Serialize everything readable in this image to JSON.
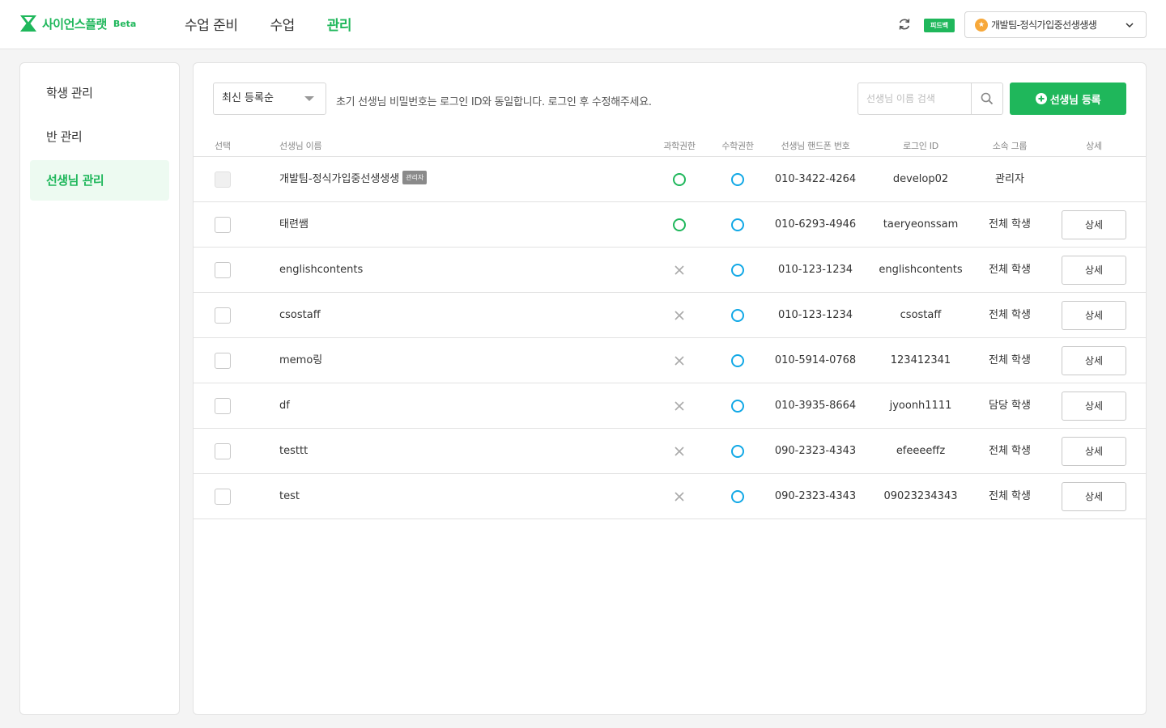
{
  "app": {
    "logo_text": "사이언스플랫",
    "beta": "Beta",
    "brand_color": "#1fb75b"
  },
  "nav": {
    "items": [
      {
        "label": "수업 준비",
        "active": false
      },
      {
        "label": "수업",
        "active": false
      },
      {
        "label": "관리",
        "active": true
      }
    ]
  },
  "header": {
    "feedback_label": "피드백",
    "user_badge": "★",
    "user_name": "개발팀-정식가입중선생생생"
  },
  "sidebar": {
    "items": [
      {
        "label": "학생 관리",
        "active": false
      },
      {
        "label": "반 관리",
        "active": false
      },
      {
        "label": "선생님 관리",
        "active": true
      }
    ]
  },
  "toolbar": {
    "sort_value": "최신 등록순",
    "notice": "초기 선생님 비밀번호는 로그인 ID와 동일합니다. 로그인 후 수정해주세요.",
    "search_placeholder": "선생님 이름 검색",
    "add_label": "선생님 등록"
  },
  "table": {
    "headers": {
      "select": "선택",
      "name": "선생님 이름",
      "science": "과학권한",
      "math": "수학권한",
      "phone": "선생님 핸드폰 번호",
      "login": "로그인 ID",
      "group": "소속 그룹",
      "detail": "상세"
    },
    "admin_tag": "관리자",
    "detail_label": "상세",
    "rows": [
      {
        "name": "개발팀-정식가입중선생생생",
        "admin": true,
        "science": true,
        "math": true,
        "phone": "010-3422-4264",
        "login": "develop02",
        "group": "관리자"
      },
      {
        "name": "태련쌤",
        "admin": false,
        "science": true,
        "math": true,
        "phone": "010-6293-4946",
        "login": "taeryeonssam",
        "group": "전체 학생"
      },
      {
        "name": "englishcontents",
        "admin": false,
        "science": false,
        "math": true,
        "phone": "010-123-1234",
        "login": "englishcontents",
        "group": "전체 학생"
      },
      {
        "name": "csostaff",
        "admin": false,
        "science": false,
        "math": true,
        "phone": "010-123-1234",
        "login": "csostaff",
        "group": "전체 학생"
      },
      {
        "name": "memo링",
        "admin": false,
        "science": false,
        "math": true,
        "phone": "010-5914-0768",
        "login": "123412341",
        "group": "전체 학생"
      },
      {
        "name": "df",
        "admin": false,
        "science": false,
        "math": true,
        "phone": "010-3935-8664",
        "login": "jyoonh1111",
        "group": "담당 학생"
      },
      {
        "name": "testtt",
        "admin": false,
        "science": false,
        "math": true,
        "phone": "090-2323-4343",
        "login": "efeeeeffz",
        "group": "전체 학생"
      },
      {
        "name": "test",
        "admin": false,
        "science": false,
        "math": true,
        "phone": "090-2323-4343",
        "login": "09023234343",
        "group": "전체 학생"
      }
    ]
  }
}
